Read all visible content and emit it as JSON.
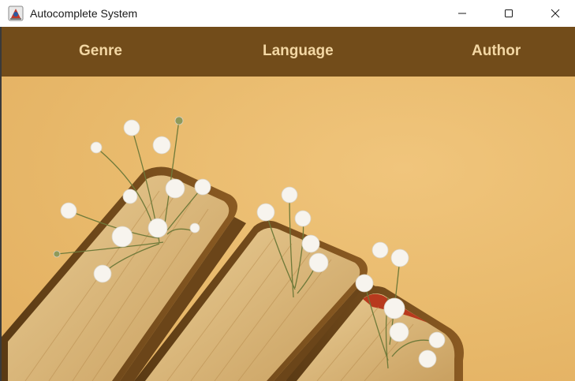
{
  "window": {
    "title": "Autocomplete System",
    "controls": [
      "minimize-icon",
      "maximize-icon",
      "close-icon"
    ]
  },
  "nav": {
    "items": [
      {
        "label": "Genre"
      },
      {
        "label": "Language"
      },
      {
        "label": "Author"
      }
    ]
  },
  "colors": {
    "navbar": "#724c1a",
    "nav_text": "#f3d7a4",
    "background": "#e8b96b"
  },
  "hero": {
    "icon": "books-with-flowers-image"
  }
}
